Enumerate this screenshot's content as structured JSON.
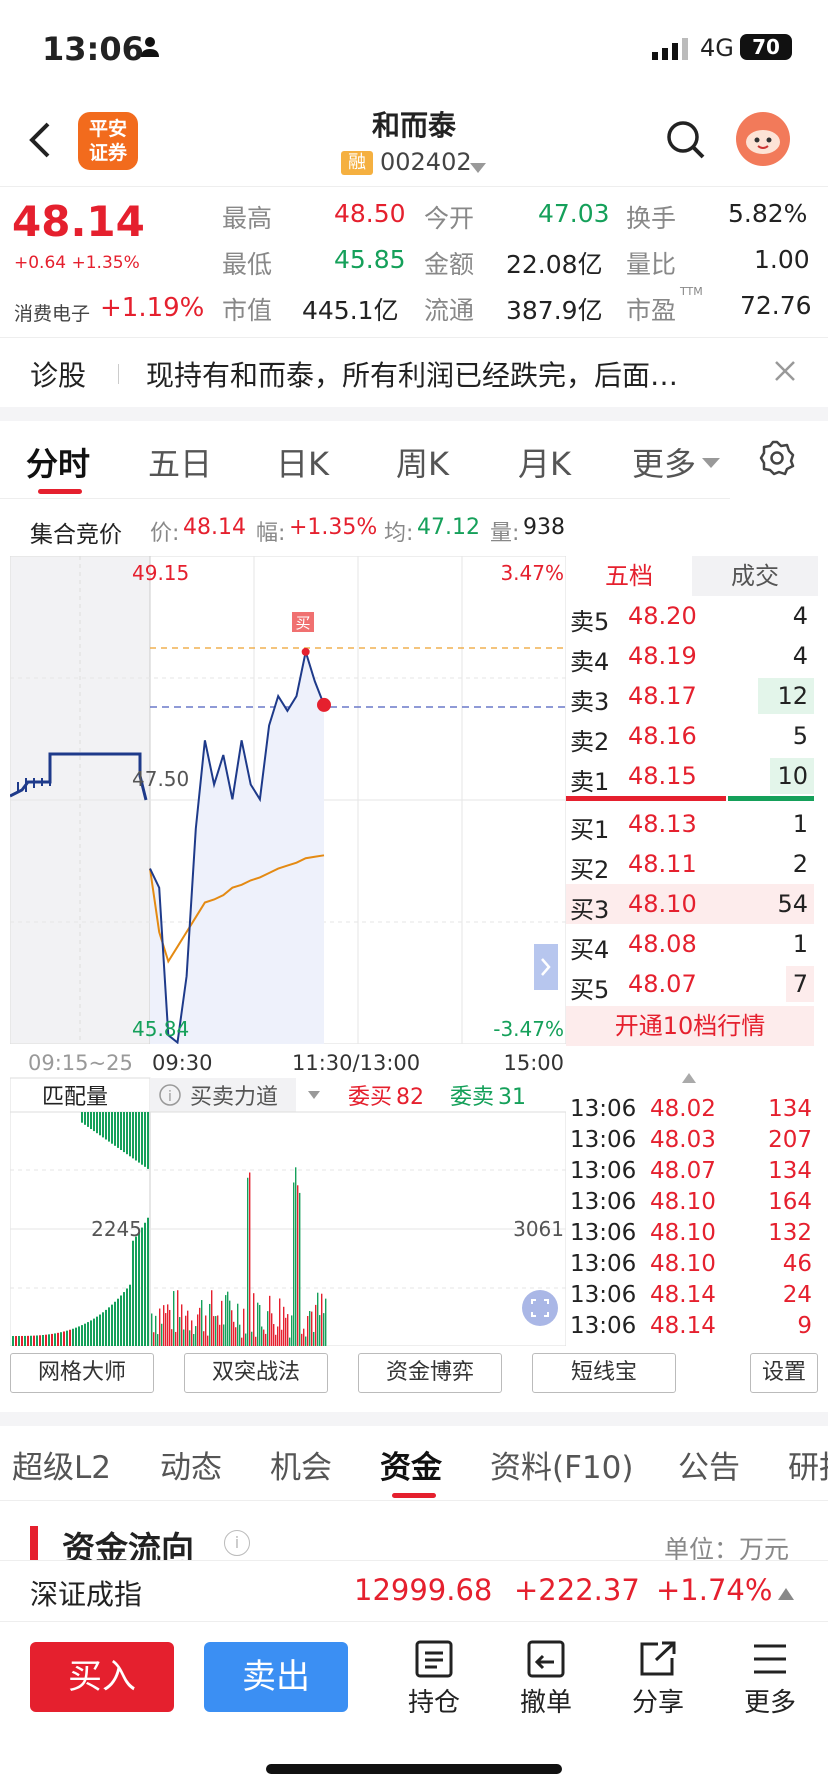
{
  "status_bar": {
    "time": "13:06",
    "network": "4G",
    "battery": "70"
  },
  "header": {
    "broker_logo": "平安\n证券",
    "stock_name": "和而泰",
    "margin_tag": "融",
    "stock_code": "002402"
  },
  "quote": {
    "price": "48.14",
    "change": "+0.64 +1.35%",
    "sector_label": "消费电子",
    "sector_change": "+1.19%",
    "cells": [
      {
        "label": "最高",
        "value": "48.50",
        "color": "red"
      },
      {
        "label": "今开",
        "value": "47.03",
        "color": "green"
      },
      {
        "label": "换手",
        "value": "5.82%",
        "color": "black"
      },
      {
        "label": "最低",
        "value": "45.85",
        "color": "green"
      },
      {
        "label": "金额",
        "value": "22.08亿",
        "color": "black"
      },
      {
        "label": "量比",
        "value": "1.00",
        "color": "black"
      },
      {
        "label": "市值",
        "value": "445.1亿",
        "color": "black"
      },
      {
        "label": "流通",
        "value": "387.9亿",
        "color": "black"
      },
      {
        "label": "市盈",
        "value": "72.76",
        "color": "black"
      }
    ],
    "pe_sup": "TTM"
  },
  "diagnose": {
    "label": "诊股",
    "text": "现持有和而泰，所有利润已经跌完，后面…"
  },
  "chart_tabs": [
    "分时",
    "五日",
    "日K",
    "周K",
    "月K",
    "更多"
  ],
  "info_line": {
    "label": "集合竞价",
    "price_label": "价:",
    "price": "48.14",
    "amp_label": "幅:",
    "amp": "+1.35%",
    "avg_label": "均:",
    "avg": "47.12",
    "vol_label": "量:",
    "vol": "938"
  },
  "chart": {
    "y_high": "49.15",
    "y_mid": "47.50",
    "y_low": "45.84",
    "pct_high": "3.47%",
    "pct_low": "-3.47%",
    "buy_marker": "买",
    "time_labels": [
      "09:15~25",
      "09:30",
      "11:30/13:00",
      "15:00"
    ],
    "vol_tab_label": "匹配量",
    "vol_tab_force": "买卖力道",
    "commission_buy_label": "委买",
    "commission_buy": "82",
    "commission_sell_label": "委卖",
    "commission_sell": "31",
    "vol_left_axis": "2245",
    "vol_right_axis": "3061"
  },
  "chart_data": {
    "type": "line",
    "title": "",
    "ylim": [
      45.84,
      49.15
    ],
    "series": [
      {
        "name": "价",
        "values": [
          47.03,
          46.9,
          45.9,
          45.85,
          46.3,
          47.3,
          47.9,
          47.6,
          47.8,
          47.5,
          47.9,
          47.6,
          47.5,
          48.0,
          48.2,
          48.1,
          48.2,
          48.5,
          48.3,
          48.14
        ]
      },
      {
        "name": "均",
        "values": [
          47.03,
          46.6,
          46.4,
          46.5,
          46.6,
          46.7,
          46.8,
          46.82,
          46.85,
          46.9,
          46.92,
          46.95,
          46.97,
          47.0,
          47.03,
          47.05,
          47.07,
          47.1,
          47.11,
          47.12
        ]
      }
    ]
  },
  "orderbook": {
    "tabs": [
      "五档",
      "成交"
    ],
    "asks": [
      {
        "label": "卖5",
        "price": "48.20",
        "vol": "4"
      },
      {
        "label": "卖4",
        "price": "48.19",
        "vol": "4"
      },
      {
        "label": "卖3",
        "price": "48.17",
        "vol": "12"
      },
      {
        "label": "卖2",
        "price": "48.16",
        "vol": "5"
      },
      {
        "label": "卖1",
        "price": "48.15",
        "vol": "10"
      }
    ],
    "bids": [
      {
        "label": "买1",
        "price": "48.13",
        "vol": "1"
      },
      {
        "label": "买2",
        "price": "48.11",
        "vol": "2"
      },
      {
        "label": "买3",
        "price": "48.10",
        "vol": "54"
      },
      {
        "label": "买4",
        "price": "48.08",
        "vol": "1"
      },
      {
        "label": "买5",
        "price": "48.07",
        "vol": "7"
      }
    ],
    "open_level10": "开通10档行情",
    "trades": [
      {
        "time": "13:06",
        "price": "48.02",
        "vol": "134"
      },
      {
        "time": "13:06",
        "price": "48.03",
        "vol": "207"
      },
      {
        "time": "13:06",
        "price": "48.07",
        "vol": "134"
      },
      {
        "time": "13:06",
        "price": "48.10",
        "vol": "164"
      },
      {
        "time": "13:06",
        "price": "48.10",
        "vol": "132"
      },
      {
        "time": "13:06",
        "price": "48.10",
        "vol": "46"
      },
      {
        "time": "13:06",
        "price": "48.14",
        "vol": "24"
      },
      {
        "time": "13:06",
        "price": "48.14",
        "vol": "9"
      }
    ]
  },
  "tools": [
    "网格大师",
    "双突战法",
    "资金博弈",
    "短线宝",
    "设置"
  ],
  "sub_tabs": [
    "超级L2",
    "动态",
    "机会",
    "资金",
    "资料(F10)",
    "公告",
    "研报"
  ],
  "fund_flow": {
    "title": "资金流向",
    "unit": "单位：万元"
  },
  "index_bar": {
    "name": "深证成指",
    "value": "12999.68",
    "change": "+222.37",
    "pct": "+1.74%"
  },
  "bottom": {
    "buy": "买入",
    "sell": "卖出",
    "position": "持仓",
    "cancel": "撤单",
    "share": "分享",
    "more": "更多"
  }
}
